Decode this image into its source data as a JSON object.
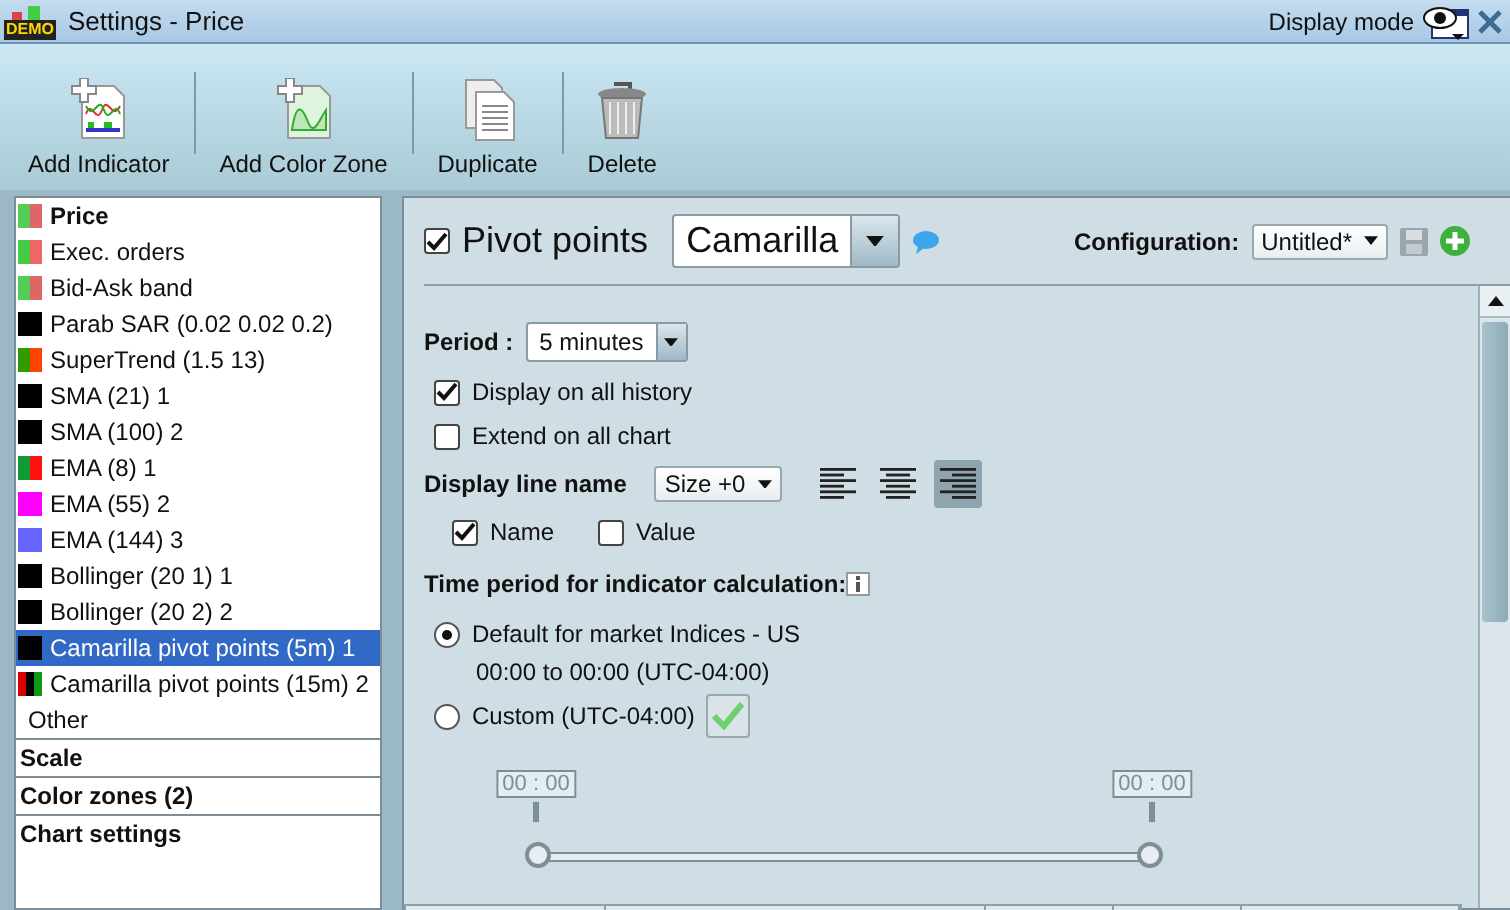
{
  "window": {
    "title": "Settings - Price",
    "app_badge": "DEMO",
    "display_mode": "Display mode"
  },
  "toolbar": [
    {
      "kind": "indicator",
      "label": "Add Indicator"
    },
    {
      "kind": "zone",
      "label": "Add Color Zone"
    },
    {
      "kind": "duplicate",
      "label": "Duplicate"
    },
    {
      "kind": "delete",
      "label": "Delete"
    }
  ],
  "sidebar": {
    "items": [
      {
        "label": "Price",
        "bold": true,
        "selected": false,
        "colors": [
          {
            "color": "#55cc55"
          },
          {
            "color": "#dd6666"
          }
        ]
      },
      {
        "label": "Exec. orders",
        "bold": false,
        "selected": false,
        "colors": [
          {
            "color": "#44cc44"
          },
          {
            "color": "#ee6666"
          }
        ]
      },
      {
        "label": "Bid-Ask band",
        "bold": false,
        "selected": false,
        "colors": [
          {
            "color": "#55cc55"
          },
          {
            "color": "#dd6666"
          }
        ]
      },
      {
        "label": "Parab SAR (0.02 0.02 0.2)",
        "bold": false,
        "selected": false,
        "colors": [
          {
            "color": "#000000"
          }
        ]
      },
      {
        "label": "SuperTrend (1.5 13)",
        "bold": false,
        "selected": false,
        "colors": [
          {
            "color": "#339900"
          },
          {
            "color": "#ff4400"
          }
        ]
      },
      {
        "label": "SMA (21) 1",
        "bold": false,
        "selected": false,
        "colors": [
          {
            "color": "#000000"
          }
        ]
      },
      {
        "label": "SMA (100) 2",
        "bold": false,
        "selected": false,
        "colors": [
          {
            "color": "#000000"
          }
        ]
      },
      {
        "label": "EMA (8) 1",
        "bold": false,
        "selected": false,
        "colors": [
          {
            "color": "#119933"
          },
          {
            "color": "#ff1111"
          }
        ]
      },
      {
        "label": "EMA (55) 2",
        "bold": false,
        "selected": false,
        "colors": [
          {
            "color": "#ff00ff"
          }
        ]
      },
      {
        "label": "EMA (144) 3",
        "bold": false,
        "selected": false,
        "colors": [
          {
            "color": "#6666ff"
          }
        ]
      },
      {
        "label": "Bollinger (20 1) 1",
        "bold": false,
        "selected": false,
        "colors": [
          {
            "color": "#000000"
          }
        ]
      },
      {
        "label": "Bollinger (20 2) 2",
        "bold": false,
        "selected": false,
        "colors": [
          {
            "color": "#000000"
          }
        ]
      },
      {
        "label": "Camarilla pivot points (5m) 1",
        "bold": false,
        "selected": true,
        "colors": [
          {
            "color": "#000000"
          }
        ]
      },
      {
        "label": "Camarilla pivot points (15m) 2",
        "bold": false,
        "selected": false,
        "colors": [
          {
            "color": "#dd0000"
          },
          {
            "color": "#000000"
          },
          {
            "color": "#119911"
          }
        ]
      },
      {
        "label": "Other",
        "bold": false,
        "selected": false
      }
    ],
    "sections": [
      "Scale",
      "Color zones (2)",
      "Chart settings"
    ]
  },
  "panel": {
    "enabled": true,
    "title": "Pivot points",
    "type_value": "Camarilla",
    "configuration_label": "Configuration:",
    "configuration_value": "Untitled*",
    "period_label": "Period :",
    "period_value": "5 minutes",
    "options": [
      {
        "label": "Display on all history",
        "checked": true
      },
      {
        "label": "Extend on all chart",
        "checked": false
      }
    ],
    "line_name_label": "Display line name",
    "size_value": "Size +0",
    "alignment": [
      {
        "kind": "left",
        "selected": false
      },
      {
        "kind": "center",
        "selected": false
      },
      {
        "kind": "right",
        "selected": true
      }
    ],
    "line_name_options": [
      {
        "label": "Name",
        "checked": true
      },
      {
        "label": "Value",
        "checked": false
      }
    ],
    "time_period_label": "Time period for indicator calculation:",
    "radios": [
      {
        "label": "Default for market Indices - US",
        "selected": true,
        "detail": "00:00 to 00:00 (UTC-04:00)"
      },
      {
        "label": "Custom (UTC-04:00)",
        "selected": false
      }
    ],
    "handles": [
      {
        "label": "00 : 00",
        "level": 0
      },
      {
        "label": "00 : 00",
        "level": 1
      }
    ]
  }
}
